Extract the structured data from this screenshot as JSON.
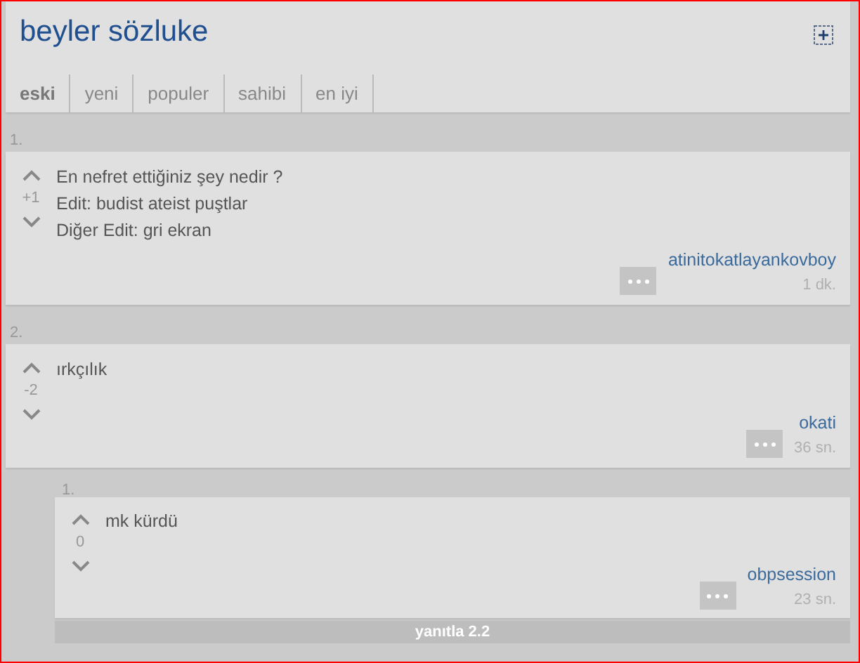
{
  "site_title": "beyler sözluke",
  "tabs": [
    {
      "label": "eski",
      "selected": true
    },
    {
      "label": "yeni",
      "selected": false
    },
    {
      "label": "populer",
      "selected": false
    },
    {
      "label": "sahibi",
      "selected": false
    },
    {
      "label": "en iyi",
      "selected": false
    }
  ],
  "entries": [
    {
      "number": "1.",
      "score": "+1",
      "lines": [
        "En nefret ettiğiniz şey nedir ?",
        "Edit: budist ateist puştlar",
        "Diğer Edit: gri ekran"
      ],
      "author": "atinitokatlayankovboy",
      "time": "1 dk."
    },
    {
      "number": "2.",
      "score": "-2",
      "lines": [
        "ırkçılık"
      ],
      "author": "okati",
      "time": "36 sn.",
      "replies": [
        {
          "number": "1.",
          "score": "0",
          "lines": [
            "mk kürdü"
          ],
          "author": "obpsession",
          "time": "23 sn."
        }
      ],
      "reply_button": "yanıtla 2.2"
    }
  ]
}
